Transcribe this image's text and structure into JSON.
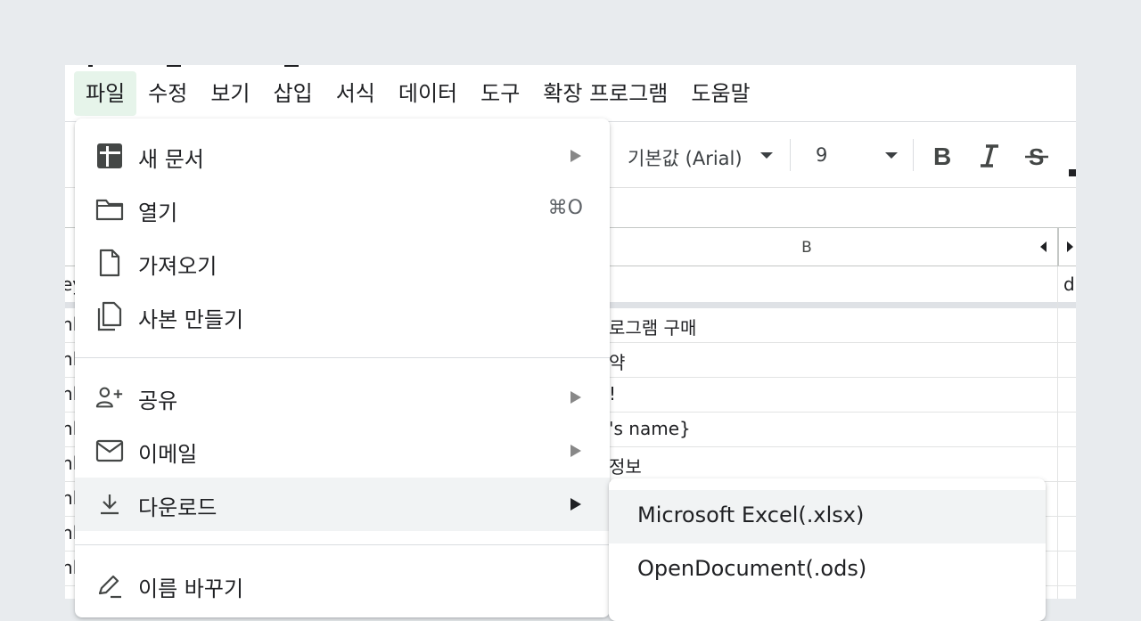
{
  "menubar": {
    "items": [
      "파일",
      "수정",
      "보기",
      "삽입",
      "서식",
      "데이터",
      "도구",
      "확장 프로그램",
      "도움말"
    ]
  },
  "toolbar": {
    "font_name": "기본값 (Arial)",
    "font_size": "9",
    "bold_glyph": "B",
    "italic_glyph": "I",
    "strike_glyph": "S"
  },
  "sheet": {
    "column_b": "B",
    "rows": [
      {
        "a": "ey",
        "b": "",
        "c": "d"
      },
      {
        "a": "nl",
        "b": "로그램 구매",
        "c": ""
      },
      {
        "a": "nl",
        "b": "약",
        "c": ""
      },
      {
        "a": "nl",
        "b": "!",
        "c": ""
      },
      {
        "a": "nl",
        "b": "'s name}",
        "c": ""
      },
      {
        "a": "nl",
        "b": "정보",
        "c": ""
      },
      {
        "a": "nl",
        "b": "",
        "c": ""
      },
      {
        "a": "nl",
        "b": "",
        "c": ""
      },
      {
        "a": "nl",
        "b": "",
        "c": ""
      }
    ]
  },
  "file_menu": {
    "new_doc": "새 문서",
    "open": "열기",
    "open_shortcut": "⌘O",
    "import": "가져오기",
    "make_copy": "사본 만들기",
    "share": "공유",
    "email": "이메일",
    "download": "다운로드",
    "rename": "이름 바꾸기"
  },
  "download_submenu": {
    "items": [
      "Microsoft Excel(.xlsx)",
      "OpenDocument(.ods)"
    ]
  },
  "colors": {
    "active_menu_bg": "#e6f4ea",
    "hover_bg": "#f1f3f4",
    "page_bg": "#e8ebee"
  }
}
